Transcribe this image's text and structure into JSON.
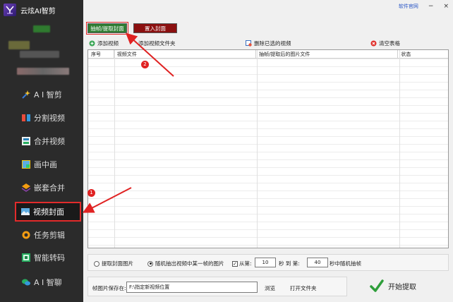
{
  "app": {
    "title": "云炫AI智剪"
  },
  "sidebar": {
    "items": [
      {
        "label": "A I 智剪",
        "icon": "ai-cut-icon"
      },
      {
        "label": "分割视频",
        "icon": "split-video-icon"
      },
      {
        "label": "合并视频",
        "icon": "merge-video-icon"
      },
      {
        "label": "画中画",
        "icon": "picture-in-picture-icon"
      },
      {
        "label": "嵌套合并",
        "icon": "nest-merge-icon"
      },
      {
        "label": "视频封面",
        "icon": "video-cover-icon"
      },
      {
        "label": "任务剪辑",
        "icon": "task-edit-icon"
      },
      {
        "label": "智能转码",
        "icon": "smart-transcode-icon"
      },
      {
        "label": "A I 智聊",
        "icon": "ai-chat-icon"
      }
    ],
    "active_index": 5
  },
  "titlebar": {
    "website_link": "软件官网",
    "minimize": "−",
    "close": "×"
  },
  "tabs": {
    "extract": "抽帧/提取封面",
    "import": "置入封面"
  },
  "toolbar": {
    "add_video": "添加视频",
    "add_folder": "添加视频文件夹",
    "delete_selected": "删除已选的视频",
    "clear_table": "清空表格"
  },
  "table": {
    "columns": [
      "序号",
      "视频文件",
      "抽帧/提取后的图片文件",
      "状态"
    ],
    "rows": []
  },
  "options": {
    "extract_cover": "提取封面图片",
    "random_frame": "随机抽出视频中某一帧的图片",
    "from_label": "从第:",
    "from_value": "10",
    "seconds_to_label": "秒 到 第:",
    "to_value": "40",
    "random_suffix": "秒中随机抽帧"
  },
  "save": {
    "label": "帧图片保存在:",
    "path": "F:\\指定新视频位置",
    "browse": "浏览",
    "open_folder": "打开文件夹"
  },
  "start_button": "开始提取",
  "annotations": {
    "badge1": "1",
    "badge2": "2",
    "color": "#e02222"
  }
}
